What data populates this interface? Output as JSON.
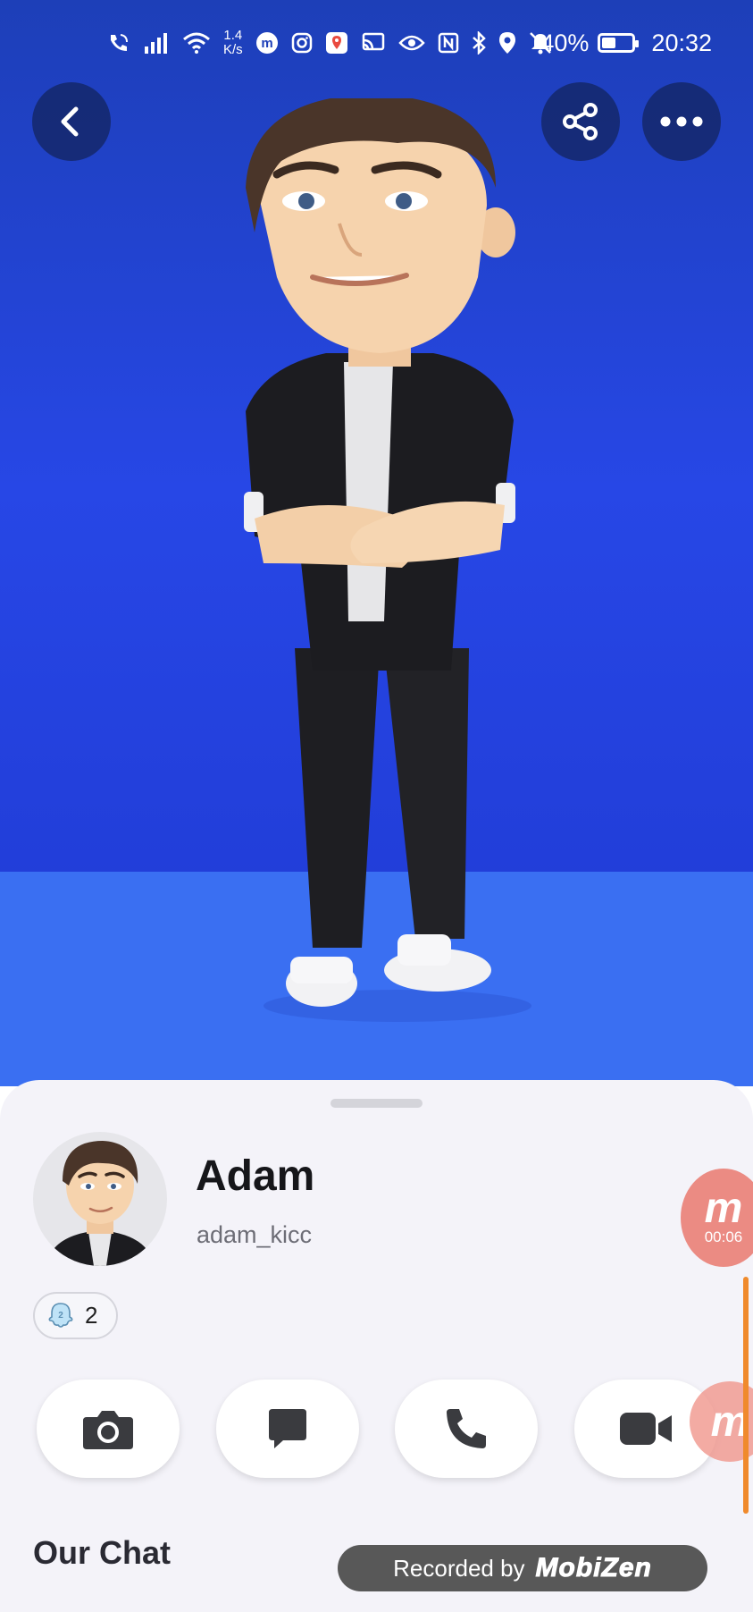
{
  "status_bar": {
    "network_speed_value": "1.4",
    "network_speed_unit": "K/s",
    "battery_percent": "40%",
    "battery_level": 0.4,
    "time": "20:32",
    "icons": [
      "wifi-calling-icon",
      "signal-icon",
      "wifi-icon",
      "mobizen-icon",
      "instagram-icon",
      "maps-icon",
      "cast-icon",
      "eye-icon",
      "nfc-icon",
      "bluetooth-icon",
      "location-icon",
      "mute-icon",
      "battery-icon"
    ]
  },
  "header": {
    "back_icon": "chevron-left-icon",
    "share_icon": "share-icon",
    "more_icon": "more-dots-icon"
  },
  "profile": {
    "name": "Adam",
    "username": "adam_kicc",
    "friend_badge_count": "2",
    "friend_badge_icon": "ghost-badge-icon"
  },
  "actions": [
    {
      "icon": "camera-icon"
    },
    {
      "icon": "chat-icon"
    },
    {
      "icon": "phone-icon"
    },
    {
      "icon": "video-camera-icon"
    }
  ],
  "section": {
    "title": "Our Chat"
  },
  "overlays": {
    "mobizen_timer": "00:06",
    "mobizen_letter": "m",
    "recorded_by": "Recorded by",
    "recorder_brand": "MobiZen"
  },
  "colors": {
    "background_top": "#1d3fb8",
    "floor": "#3a6ff2",
    "sheet": "#f4f3f9",
    "mobizen_accent": "#e9786e",
    "edge_bar": "#f08a2c"
  }
}
